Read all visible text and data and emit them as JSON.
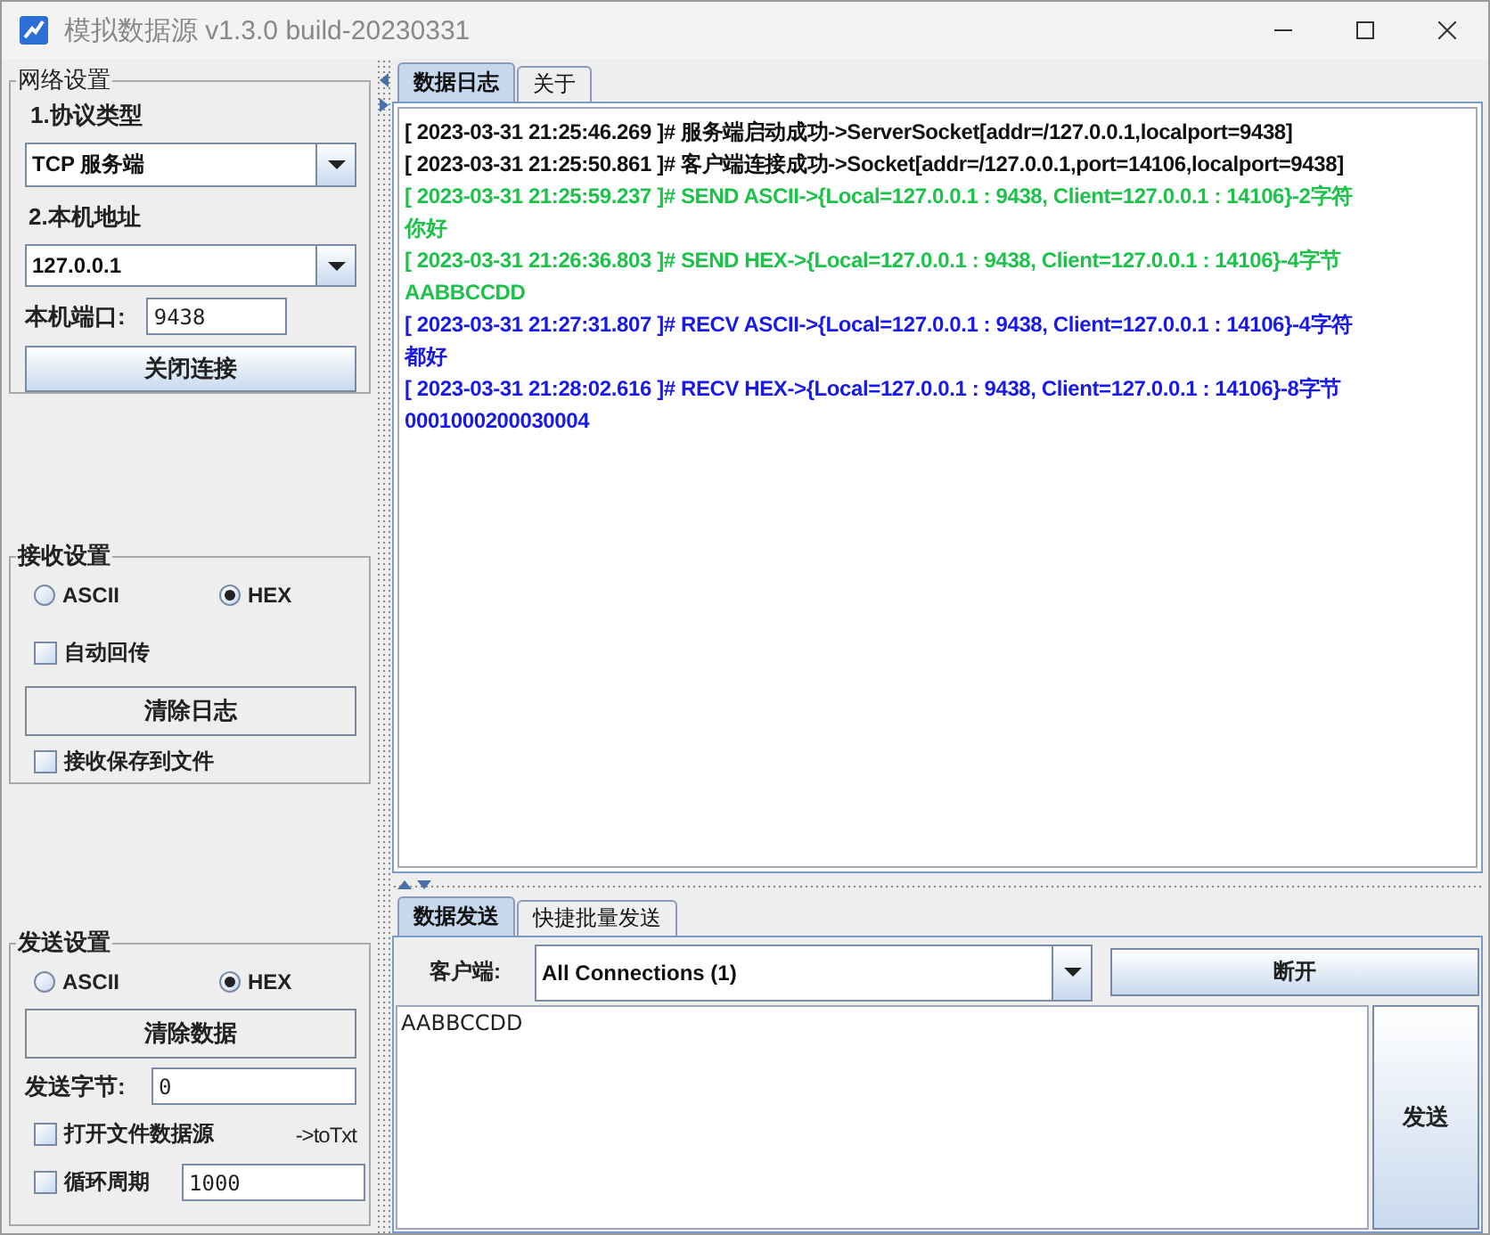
{
  "window": {
    "title": "模拟数据源 v1.3.0 build-20230331"
  },
  "network_settings": {
    "title": "网络设置",
    "protocol_label": "1.协议类型",
    "protocol": "TCP 服务端",
    "address_label": "2.本机地址",
    "address": "127.0.0.1",
    "port_label": "本机端口:",
    "port": "9438",
    "connect_button": "关闭连接"
  },
  "receive_settings": {
    "title": "接收设置",
    "modes": [
      {
        "label": "ASCII",
        "selected": false
      },
      {
        "label": "HEX",
        "selected": true
      }
    ],
    "auto_reply": {
      "label": "自动回传",
      "checked": false
    },
    "clear_button": "清除日志",
    "save_to_file": {
      "label": "接收保存到文件",
      "checked": false
    }
  },
  "send_settings": {
    "title": "发送设置",
    "modes": [
      {
        "label": "ASCII",
        "selected": false
      },
      {
        "label": "HEX",
        "selected": true
      }
    ],
    "clear_button": "清除数据",
    "bytes_label": "发送字节:",
    "bytes": "0",
    "file_source": {
      "label": "打开文件数据源",
      "checked": false
    },
    "to_txt_link": "->toTxt",
    "loop": {
      "label": "循环周期",
      "checked": false
    },
    "period": "1000"
  },
  "log_tabs": [
    {
      "label": "数据日志",
      "selected": true
    },
    {
      "label": "关于",
      "selected": false
    }
  ],
  "log": [
    {
      "kind": "info",
      "text": "[ 2023-03-31 21:25:46.269 ]# 服务端启动成功->ServerSocket[addr=/127.0.0.1,localport=9438]"
    },
    {
      "kind": "info",
      "text": "[ 2023-03-31 21:25:50.861 ]# 客户端连接成功->Socket[addr=/127.0.0.1,port=14106,localport=9438]"
    },
    {
      "kind": "send",
      "text": "[ 2023-03-31 21:25:59.237 ]# SEND ASCII->{Local=127.0.0.1 : 9438, Client=127.0.0.1 : 14106}-2字符"
    },
    {
      "kind": "send",
      "text": "你好"
    },
    {
      "kind": "send",
      "text": "[ 2023-03-31 21:26:36.803 ]# SEND HEX->{Local=127.0.0.1 : 9438, Client=127.0.0.1 : 14106}-4字节"
    },
    {
      "kind": "send",
      "text": "AABBCCDD"
    },
    {
      "kind": "recv",
      "text": "[ 2023-03-31 21:27:31.807 ]# RECV ASCII->{Local=127.0.0.1 : 9438, Client=127.0.0.1 : 14106}-4字符"
    },
    {
      "kind": "recv",
      "text": "都好"
    },
    {
      "kind": "recv",
      "text": "[ 2023-03-31 21:28:02.616 ]# RECV HEX->{Local=127.0.0.1 : 9438, Client=127.0.0.1 : 14106}-8字节"
    },
    {
      "kind": "recv",
      "text": "0001000200030004"
    }
  ],
  "send_tabs": [
    {
      "label": "数据发送",
      "selected": true
    },
    {
      "label": "快捷批量发送",
      "selected": false
    }
  ],
  "send_panel": {
    "client_label": "客户端:",
    "client": "All Connections (1)",
    "disconnect_button": "断开",
    "data": "AABBCCDD",
    "send_button": "发送"
  }
}
